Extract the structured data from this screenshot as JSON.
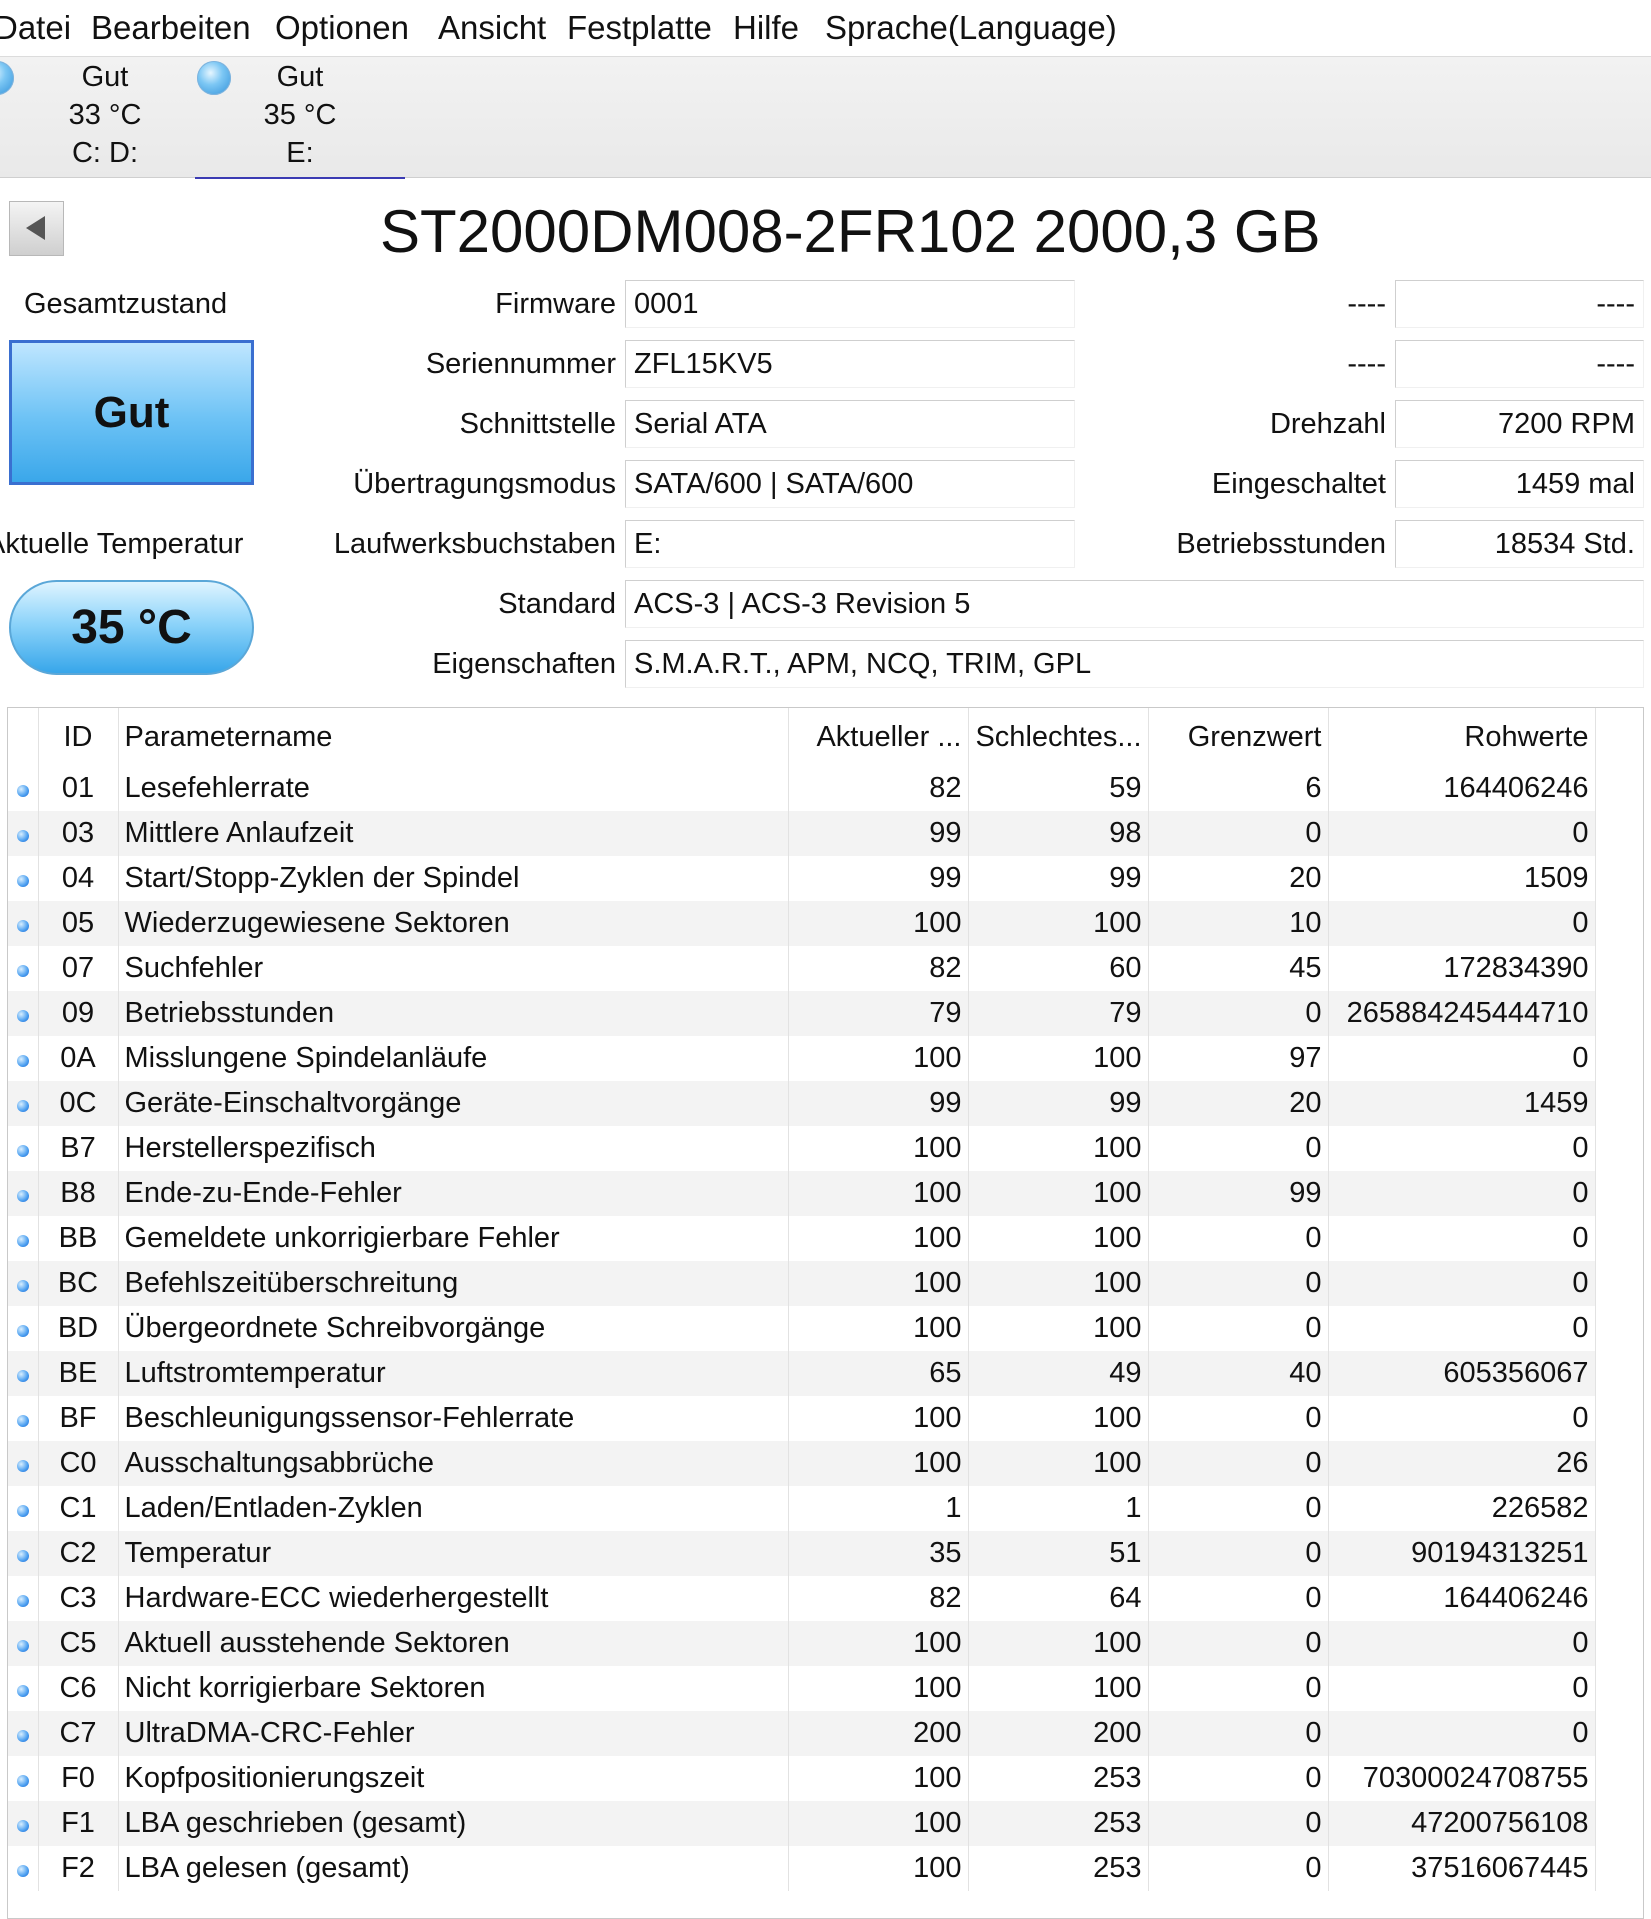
{
  "menu": [
    "Datei",
    "Bearbeiten",
    "Optionen",
    "Ansicht",
    "Festplatte",
    "Hilfe",
    "Sprache(Language)"
  ],
  "drives": [
    {
      "status": "Gut",
      "temp": "33 °C",
      "letters": "C: D:",
      "selected": false
    },
    {
      "status": "Gut",
      "temp": "35 °C",
      "letters": "E:",
      "selected": true
    }
  ],
  "disk": {
    "title": "ST2000DM008-2FR102 2000,3 GB",
    "health_label": "Gesamtzustand",
    "health": "Gut",
    "temp_label": "Aktuelle Temperatur",
    "temp": "35 °C"
  },
  "fields_left": [
    {
      "label": "Firmware",
      "value": "0001"
    },
    {
      "label": "Seriennummer",
      "value": "ZFL15KV5"
    },
    {
      "label": "Schnittstelle",
      "value": "Serial ATA"
    },
    {
      "label": "Übertragungsmodus",
      "value": "SATA/600 | SATA/600"
    },
    {
      "label": "Laufwerksbuchstaben",
      "value": "E:"
    },
    {
      "label": "Standard",
      "value": "ACS-3 | ACS-3 Revision 5"
    },
    {
      "label": "Eigenschaften",
      "value": "S.M.A.R.T., APM, NCQ, TRIM, GPL"
    }
  ],
  "fields_right": [
    {
      "label": "----",
      "value": "----"
    },
    {
      "label": "----",
      "value": "----"
    },
    {
      "label": "Drehzahl",
      "value": "7200 RPM"
    },
    {
      "label": "Eingeschaltet",
      "value": "1459 mal"
    },
    {
      "label": "Betriebsstunden",
      "value": "18534 Std."
    }
  ],
  "smart": {
    "headers": [
      "ID",
      "Parametername",
      "Aktueller ...",
      "Schlechtes...",
      "Grenzwert",
      "Rohwerte"
    ],
    "rows": [
      [
        "01",
        "Lesefehlerrate",
        "82",
        "59",
        "6",
        "164406246"
      ],
      [
        "03",
        "Mittlere Anlaufzeit",
        "99",
        "98",
        "0",
        "0"
      ],
      [
        "04",
        "Start/Stopp-Zyklen der Spindel",
        "99",
        "99",
        "20",
        "1509"
      ],
      [
        "05",
        "Wiederzugewiesene Sektoren",
        "100",
        "100",
        "10",
        "0"
      ],
      [
        "07",
        "Suchfehler",
        "82",
        "60",
        "45",
        "172834390"
      ],
      [
        "09",
        "Betriebsstunden",
        "79",
        "79",
        "0",
        "265884245444710"
      ],
      [
        "0A",
        "Misslungene Spindelanläufe",
        "100",
        "100",
        "97",
        "0"
      ],
      [
        "0C",
        "Geräte-Einschaltvorgänge",
        "99",
        "99",
        "20",
        "1459"
      ],
      [
        "B7",
        "Herstellerspezifisch",
        "100",
        "100",
        "0",
        "0"
      ],
      [
        "B8",
        "Ende-zu-Ende-Fehler",
        "100",
        "100",
        "99",
        "0"
      ],
      [
        "BB",
        "Gemeldete unkorrigierbare Fehler",
        "100",
        "100",
        "0",
        "0"
      ],
      [
        "BC",
        "Befehlszeitüberschreitung",
        "100",
        "100",
        "0",
        "0"
      ],
      [
        "BD",
        "Übergeordnete Schreibvorgänge",
        "100",
        "100",
        "0",
        "0"
      ],
      [
        "BE",
        "Luftstromtemperatur",
        "65",
        "49",
        "40",
        "605356067"
      ],
      [
        "BF",
        "Beschleunigungssensor-Fehlerrate",
        "100",
        "100",
        "0",
        "0"
      ],
      [
        "C0",
        "Ausschaltungsabbrüche",
        "100",
        "100",
        "0",
        "26"
      ],
      [
        "C1",
        "Laden/Entladen-Zyklen",
        "1",
        "1",
        "0",
        "226582"
      ],
      [
        "C2",
        "Temperatur",
        "35",
        "51",
        "0",
        "90194313251"
      ],
      [
        "C3",
        "Hardware-ECC wiederhergestellt",
        "82",
        "64",
        "0",
        "164406246"
      ],
      [
        "C5",
        "Aktuell ausstehende Sektoren",
        "100",
        "100",
        "0",
        "0"
      ],
      [
        "C6",
        "Nicht korrigierbare Sektoren",
        "100",
        "100",
        "0",
        "0"
      ],
      [
        "C7",
        "UltraDMA-CRC-Fehler",
        "200",
        "200",
        "0",
        "0"
      ],
      [
        "F0",
        "Kopfpositionierungszeit",
        "100",
        "253",
        "0",
        "70300024708755"
      ],
      [
        "F1",
        "LBA geschrieben (gesamt)",
        "100",
        "253",
        "0",
        "47200756108"
      ],
      [
        "F2",
        "LBA gelesen (gesamt)",
        "100",
        "253",
        "0",
        "37516067445"
      ]
    ]
  },
  "colors": {
    "accent": "#3aa7ea",
    "selected_underline": "#3b3bb3",
    "status_dot": "#4a9ef0"
  }
}
